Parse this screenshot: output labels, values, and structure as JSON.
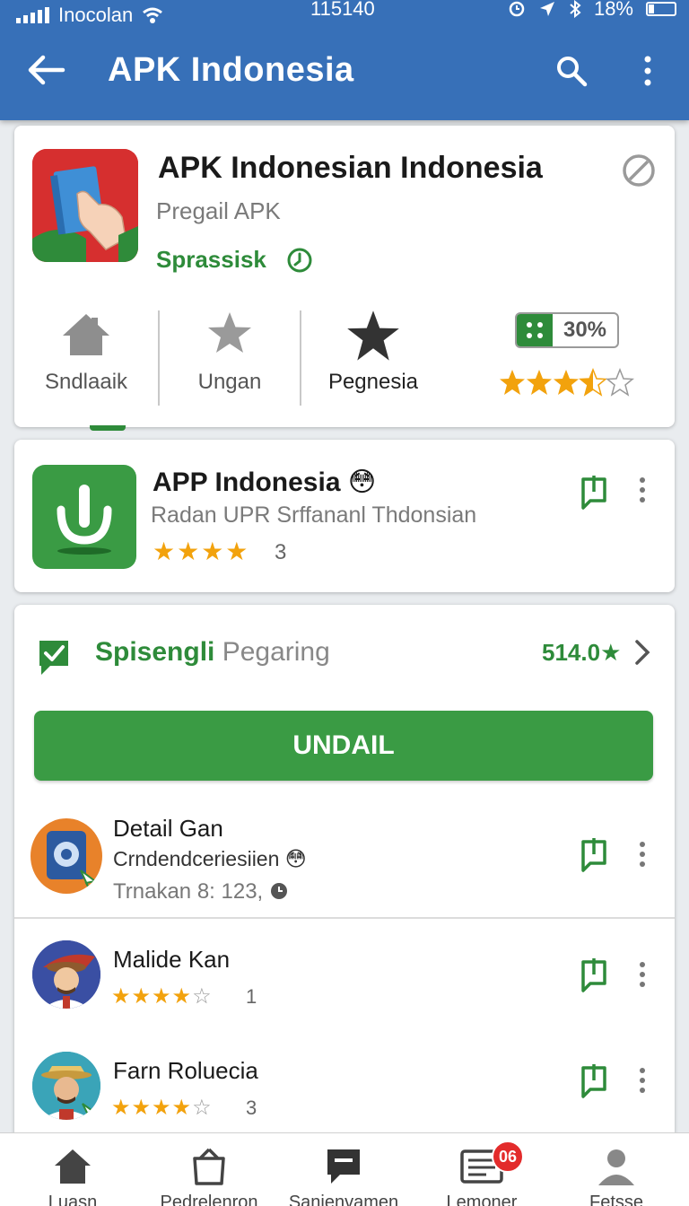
{
  "status_bar": {
    "carrier": "Inocolan",
    "time": "115140",
    "battery": "18%"
  },
  "app_bar": {
    "title": "APK Indonesia"
  },
  "featured": {
    "title": "APK Indonesian Indonesia",
    "subtitle": "Pregail APK",
    "status": "Sprassisk",
    "tabs": [
      {
        "label": "Sndlaaik",
        "icon": "home-icon"
      },
      {
        "label": "Ungan",
        "icon": "star-icon"
      },
      {
        "label": "Pegnesia",
        "icon": "star-icon"
      }
    ],
    "badge_percent": "30%",
    "rating_stars": 3.5
  },
  "app_row": {
    "title": "APP Indonesia",
    "emoji": "😳",
    "subtitle": "Radan UPR Srffananl Thdonsian",
    "stars": "★★★★",
    "count": "3"
  },
  "recommended": {
    "title_main": "Spisengli",
    "title_rest": "Pegaring",
    "rating": "514.0★",
    "install_label": "UNDAIL",
    "items": [
      {
        "name": "Detail Gan",
        "line2": "Crndendceriesiien",
        "emoji": "😳",
        "line3": "Trnakan 8:  123,"
      },
      {
        "name": "Malide Kan",
        "stars": "★★★★",
        "empty_star": "☆",
        "count": "1"
      },
      {
        "name": "Farn Roluecia",
        "stars": "★★★★",
        "empty_star": "☆",
        "count": "3"
      }
    ]
  },
  "bottom_nav": {
    "items": [
      {
        "label": "Luasn",
        "icon": "home-icon"
      },
      {
        "label": "Pedrelenron",
        "icon": "bag-icon"
      },
      {
        "label": "Sanienvamen",
        "icon": "chat-icon"
      },
      {
        "label": "Lemoner",
        "icon": "inbox-icon"
      },
      {
        "label": "Fetsse",
        "icon": "profile-icon"
      }
    ],
    "notification_count": "06"
  },
  "colors": {
    "primary": "#3770b8",
    "green": "#2e8b3a",
    "star": "#f2a20d",
    "badge": "#e32b2b"
  }
}
